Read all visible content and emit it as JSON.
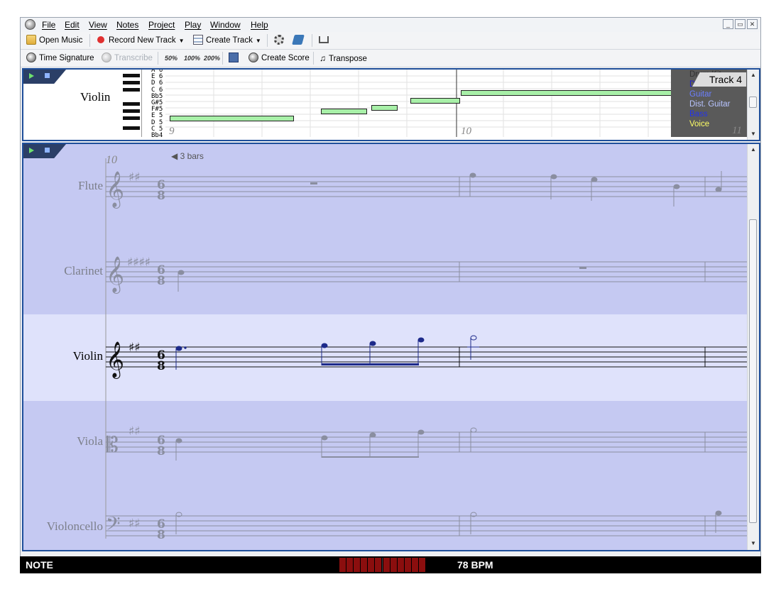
{
  "menu": [
    "File",
    "Edit",
    "View",
    "Notes",
    "Project",
    "Play",
    "Window",
    "Help"
  ],
  "window_controls": [
    "_",
    "▭",
    "✕"
  ],
  "toolbar1": {
    "open_music": "Open Music",
    "record_new_track": "Record New Track",
    "create_track": "Create Track"
  },
  "toolbar2": {
    "time_signature": "Time Signature",
    "transcribe": "Transcribe",
    "speed_50": "50%",
    "speed_100": "100%",
    "speed_200": "200%",
    "create_score": "Create Score",
    "transpose": "Transpose"
  },
  "piano_roll": {
    "instrument": "Violin",
    "note_names": [
      "A 6",
      "E 6",
      "D 6",
      "C 6",
      "Bb5",
      "G#5",
      "F#5",
      "E 5",
      "D 5",
      "C 5",
      "Bb4"
    ],
    "bar_numbers": [
      "9",
      "10",
      "11"
    ],
    "track_badge": "Track 4",
    "tracks": [
      {
        "name": "Drum Kit",
        "color": "#333333"
      },
      {
        "name": "Drums",
        "color": "#2222cc"
      },
      {
        "name": "Guitar",
        "color": "#6b7fff"
      },
      {
        "name": "Dist. Guitar",
        "color": "#b8c4ff"
      },
      {
        "name": "Bass",
        "color": "#2233ee"
      },
      {
        "name": "Voice",
        "color": "#ffff66"
      }
    ]
  },
  "score": {
    "start_bar": "10",
    "bars_nav": "3 bars",
    "time_signature": {
      "top": "6",
      "bottom": "8"
    },
    "staves": [
      {
        "name": "Flute",
        "active": false
      },
      {
        "name": "Clarinet",
        "active": false
      },
      {
        "name": "Violin",
        "active": true
      },
      {
        "name": "Viola",
        "active": false
      },
      {
        "name": "Violoncello",
        "active": false
      }
    ]
  },
  "status": {
    "mode": "NOTE",
    "tempo": "78 BPM"
  },
  "colors": {
    "score_bg": "#c5c9f2",
    "active_staff_bg": "#dfe2fb",
    "pane_border": "#1f4f9a",
    "note_bar": "#a8f0a8",
    "status_bg": "#000000",
    "meter": "#8b0e0e"
  }
}
